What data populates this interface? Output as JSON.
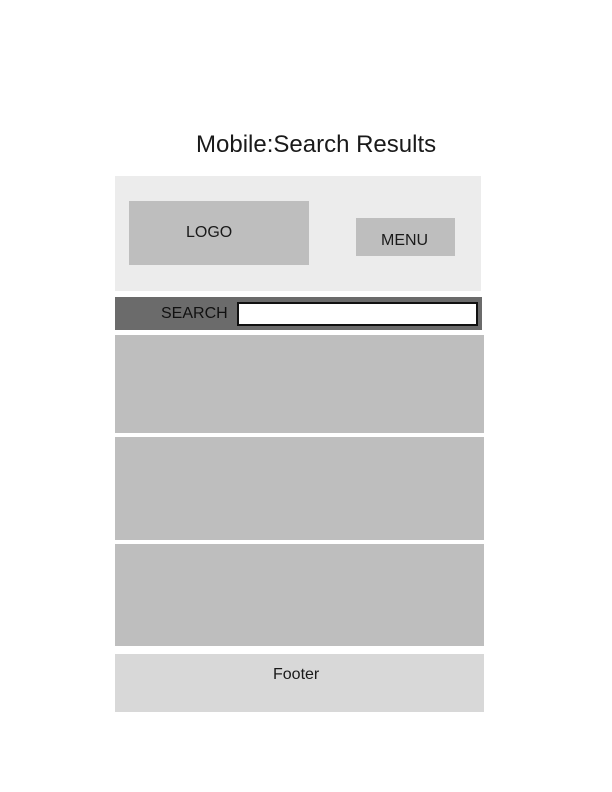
{
  "title": "Mobile:Search Results",
  "header": {
    "logo_label": "LOGO",
    "menu_label": "MENU"
  },
  "search": {
    "label": "SEARCH",
    "value": ""
  },
  "results": [
    "",
    "",
    ""
  ],
  "footer": {
    "label": "Footer"
  },
  "colors": {
    "header_bg": "#ececec",
    "block_gray": "#bebebe",
    "search_bar_bg": "#6b6b6b",
    "footer_bg": "#d8d8d8"
  }
}
